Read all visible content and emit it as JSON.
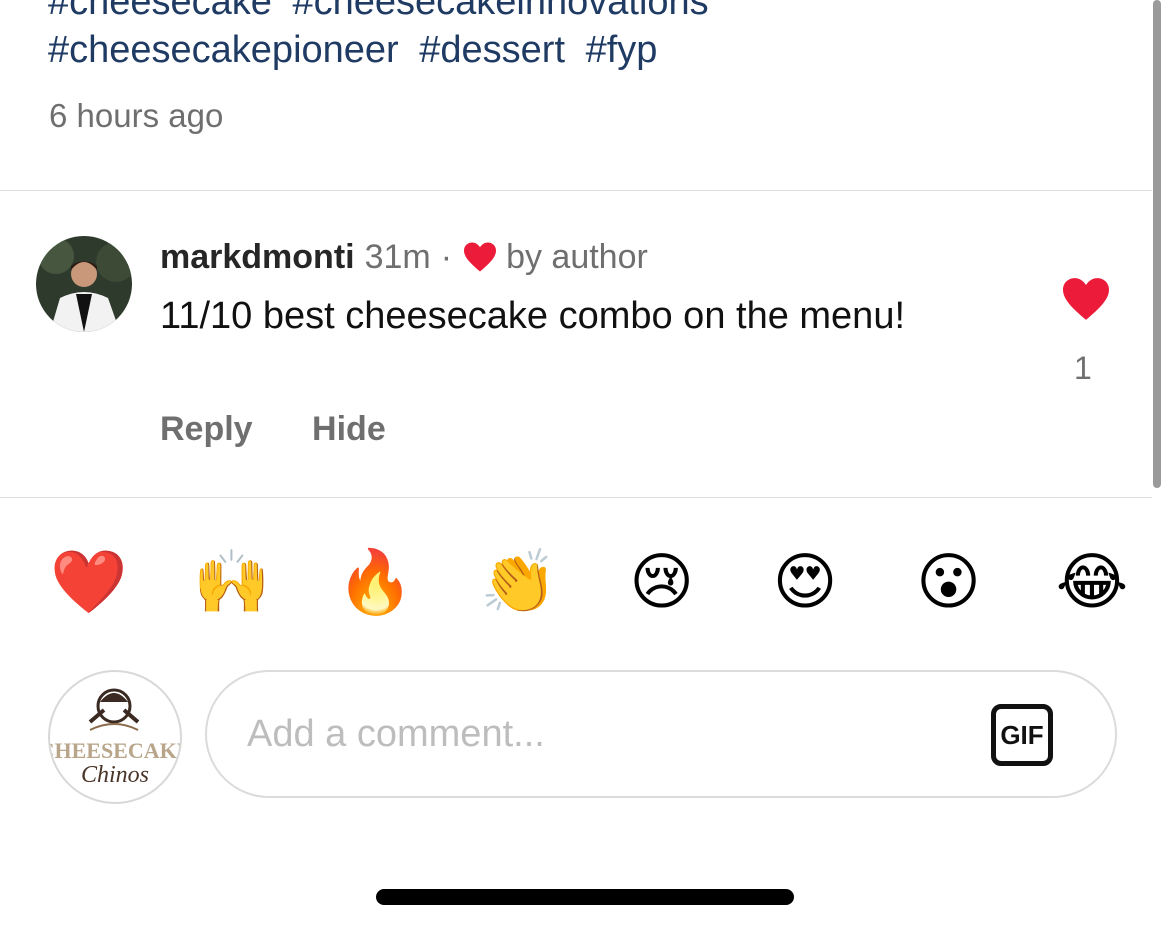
{
  "caption": {
    "hashtags_line1": [
      "#cheesecake",
      "#cheesecakeinnovations"
    ],
    "hashtags_line2": [
      "#cheesecakepioneer",
      "#dessert",
      "#fyp"
    ],
    "timestamp": "6 hours ago"
  },
  "comment": {
    "username": "markdmonti",
    "time": "31m",
    "separator": "·",
    "liked_by_author_label": "by author",
    "text": "11/10 best cheesecake combo on the menu!",
    "reply_label": "Reply",
    "hide_label": "Hide",
    "like_count": "1",
    "colors": {
      "heart": "#ed1b3a",
      "meta": "#6f6f6f"
    }
  },
  "reactions": [
    {
      "icon": "red-heart",
      "glyph": "❤️"
    },
    {
      "icon": "raising-hands",
      "glyph": "🙌"
    },
    {
      "icon": "fire",
      "glyph": "🔥"
    },
    {
      "icon": "clapping-hands",
      "glyph": "👏"
    },
    {
      "icon": "crying-face",
      "glyph": "😢"
    },
    {
      "icon": "heart-eyes-face",
      "glyph": "😍"
    },
    {
      "icon": "surprised-face",
      "glyph": "😮"
    },
    {
      "icon": "tears-of-joy-face",
      "glyph": "😂"
    }
  ],
  "composer": {
    "placeholder": "Add a comment...",
    "gif_label": "GIF",
    "own_avatar_logo_text": [
      "CHEESECAKE",
      "Chinos"
    ]
  },
  "colors": {
    "hashtag": "#1f3b63",
    "divider": "#dcdcdc",
    "placeholder": "#bdbdbd"
  }
}
